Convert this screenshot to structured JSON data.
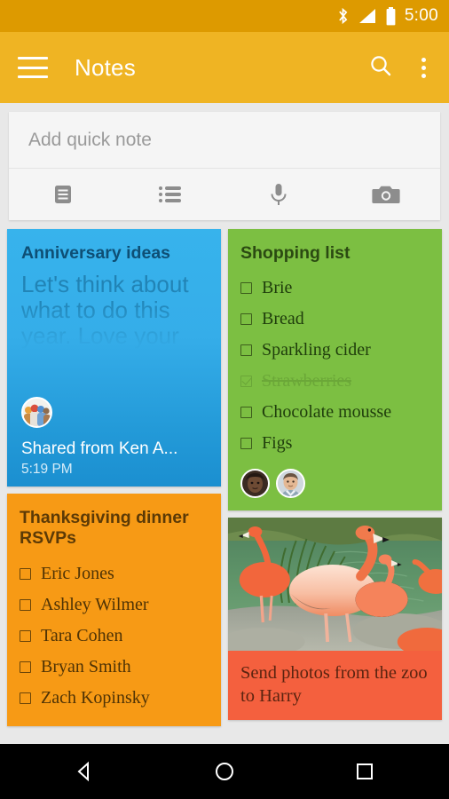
{
  "status_bar": {
    "time": "5:00",
    "icons": [
      "bluetooth-icon",
      "signal-icon",
      "battery-icon"
    ]
  },
  "app_bar": {
    "title": "Notes",
    "menu_icon": "hamburger-menu-icon",
    "search_icon": "search-icon",
    "overflow_icon": "overflow-menu-icon"
  },
  "quick_note": {
    "placeholder": "Add quick note",
    "value": "",
    "actions": [
      {
        "name": "text-note-icon",
        "label": "Text note"
      },
      {
        "name": "list-note-icon",
        "label": "List note"
      },
      {
        "name": "microphone-icon",
        "label": "Voice note"
      },
      {
        "name": "camera-icon",
        "label": "Photo note"
      }
    ]
  },
  "notes": {
    "anniversary": {
      "title": "Anniversary ideas",
      "body": "Let's think about what to do this year. Love your",
      "shared_by": "Shared from Ken A...",
      "timestamp": "5:19 PM",
      "color": "#35ade9"
    },
    "shopping": {
      "title": "Shopping list",
      "color": "#7cbf42",
      "items": [
        {
          "text": "Brie",
          "checked": false
        },
        {
          "text": "Bread",
          "checked": false
        },
        {
          "text": "Sparkling cider",
          "checked": false
        },
        {
          "text": "Strawberries",
          "checked": true
        },
        {
          "text": "Chocolate mousse",
          "checked": false
        },
        {
          "text": "Figs",
          "checked": false
        }
      ],
      "collaborators": [
        "avatar-woman",
        "avatar-man"
      ]
    },
    "thanksgiving": {
      "title": "Thanksgiving dinner RSVPs",
      "color": "#f79a15",
      "items": [
        {
          "text": "Eric Jones",
          "checked": false
        },
        {
          "text": "Ashley Wilmer",
          "checked": false
        },
        {
          "text": "Tara Cohen",
          "checked": false
        },
        {
          "text": "Bryan Smith",
          "checked": false
        },
        {
          "text": "Zach Kopinsky",
          "checked": false
        }
      ]
    },
    "zoo_photo": {
      "caption": "Send photos from the zoo to Harry",
      "color": "#f4603e",
      "image": "flamingos-photo"
    }
  },
  "nav_bar": {
    "back": "back-button",
    "home": "home-button",
    "recents": "recents-button"
  }
}
